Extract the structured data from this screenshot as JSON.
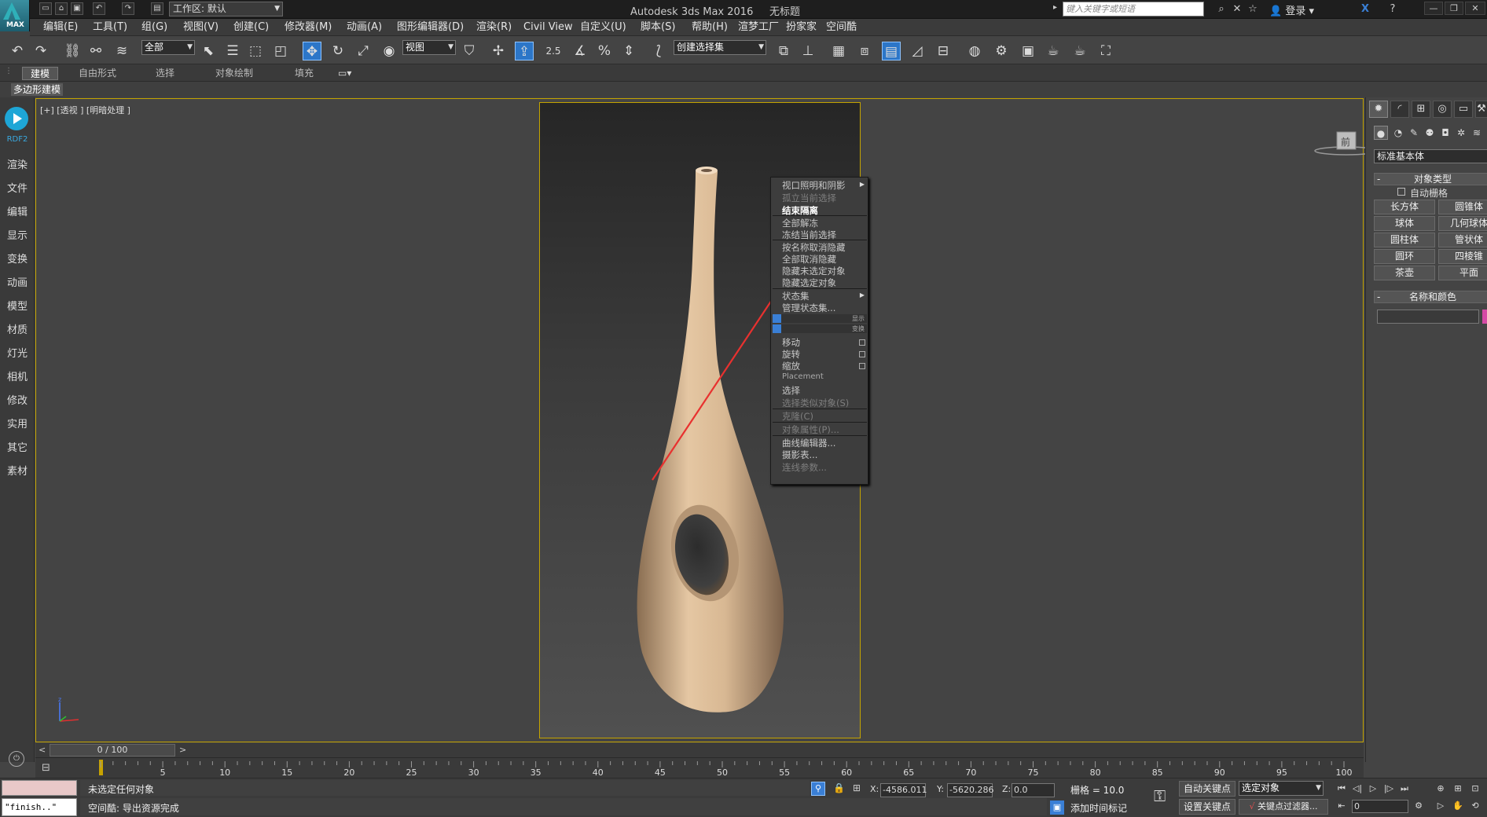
{
  "app": {
    "logo_text": "MAX",
    "workspace": "工作区: 默认",
    "title": "Autodesk 3ds Max 2016",
    "file_name": "无标题",
    "search_placeholder": "键入关键字或短语",
    "login": "登录"
  },
  "menubar": [
    "编辑(E)",
    "工具(T)",
    "组(G)",
    "视图(V)",
    "创建(C)",
    "修改器(M)",
    "动画(A)",
    "图形编辑器(D)",
    "渲染(R)",
    "Civil View",
    "自定义(U)",
    "脚本(S)",
    "帮助(H)",
    "渲梦工厂",
    "扮家家",
    "空间酷"
  ],
  "toolbar": {
    "selection_filter": "全部",
    "ref_coord": "视图",
    "snap_value": "2.5",
    "named_selection": "创建选择集"
  },
  "ribbon": {
    "tabs": [
      "建模",
      "自由形式",
      "选择",
      "对象绘制",
      "填充"
    ],
    "sub_label": "多边形建模"
  },
  "sidebar": {
    "logo_text": "RDF2",
    "items": [
      "渲染",
      "文件",
      "编辑",
      "显示",
      "变换",
      "动画",
      "模型",
      "材质",
      "灯光",
      "相机",
      "修改",
      "实用",
      "其它",
      "素材"
    ]
  },
  "viewport": {
    "label": "[+] [透视 ] [明暗处理 ]",
    "viewcube_label": "前"
  },
  "context_menu": {
    "top": [
      {
        "label": "视口照明和阴影",
        "submenu": true,
        "disabled": false
      },
      {
        "label": "孤立当前选择",
        "disabled": true
      },
      {
        "label": "结束隔离",
        "disabled": false,
        "highlight": true
      },
      {
        "label": "全部解冻",
        "disabled": false
      },
      {
        "label": "冻结当前选择",
        "disabled": false
      },
      {
        "label": "按名称取消隐藏",
        "disabled": false
      },
      {
        "label": "全部取消隐藏",
        "disabled": false
      },
      {
        "label": "隐藏未选定对象",
        "disabled": false
      },
      {
        "label": "隐藏选定对象",
        "disabled": false
      },
      {
        "label": "状态集",
        "submenu": true,
        "disabled": false
      },
      {
        "label": "管理状态集...",
        "disabled": false
      }
    ],
    "quad_labels": [
      "显示",
      "变换"
    ],
    "bottom": [
      {
        "label": "移动",
        "box": true
      },
      {
        "label": "旋转",
        "box": true
      },
      {
        "label": "缩放",
        "box": true
      },
      {
        "label": "Placement"
      },
      {
        "label": "选择"
      },
      {
        "label": "选择类似对象(S)",
        "disabled": true
      },
      {
        "label": "克隆(C)",
        "disabled": true
      },
      {
        "label": "对象属性(P)...",
        "disabled": true
      },
      {
        "label": "曲线编辑器..."
      },
      {
        "label": "摄影表..."
      },
      {
        "label": "连线参数...",
        "disabled": true
      }
    ]
  },
  "command_panel": {
    "dropdown": "标准基本体",
    "object_type_header": "对象类型",
    "auto_grid": "自动栅格",
    "buttons": [
      "长方体",
      "圆锥体",
      "球体",
      "几何球体",
      "圆柱体",
      "管状体",
      "圆环",
      "四棱锥",
      "茶壶",
      "平面"
    ],
    "name_color_header": "名称和颜色",
    "swatch_color": "#d64aa5"
  },
  "timeline": {
    "frame_display": "0 / 100",
    "ticks": [
      "5",
      "10",
      "15",
      "20",
      "25",
      "30",
      "35",
      "40",
      "45",
      "50",
      "55",
      "60",
      "65",
      "70",
      "75",
      "80",
      "85",
      "90",
      "95",
      "100"
    ]
  },
  "status": {
    "maxscript_out": "\"finish..\"",
    "selection": "未选定任何对象",
    "prompt": "空间酷: 导出资源完成",
    "x_label": "X:",
    "x_value": "-4586.011",
    "y_label": "Y:",
    "y_value": "-5620.286",
    "z_label": "Z:",
    "z_value": "0.0",
    "grid": "栅格 = 10.0",
    "add_time_tag": "添加时间标记",
    "auto_key": "自动关键点",
    "set_key": "设置关键点",
    "selected_dropdown": "选定对象",
    "key_filters": "关键点过滤器...",
    "frame_input": "0"
  }
}
